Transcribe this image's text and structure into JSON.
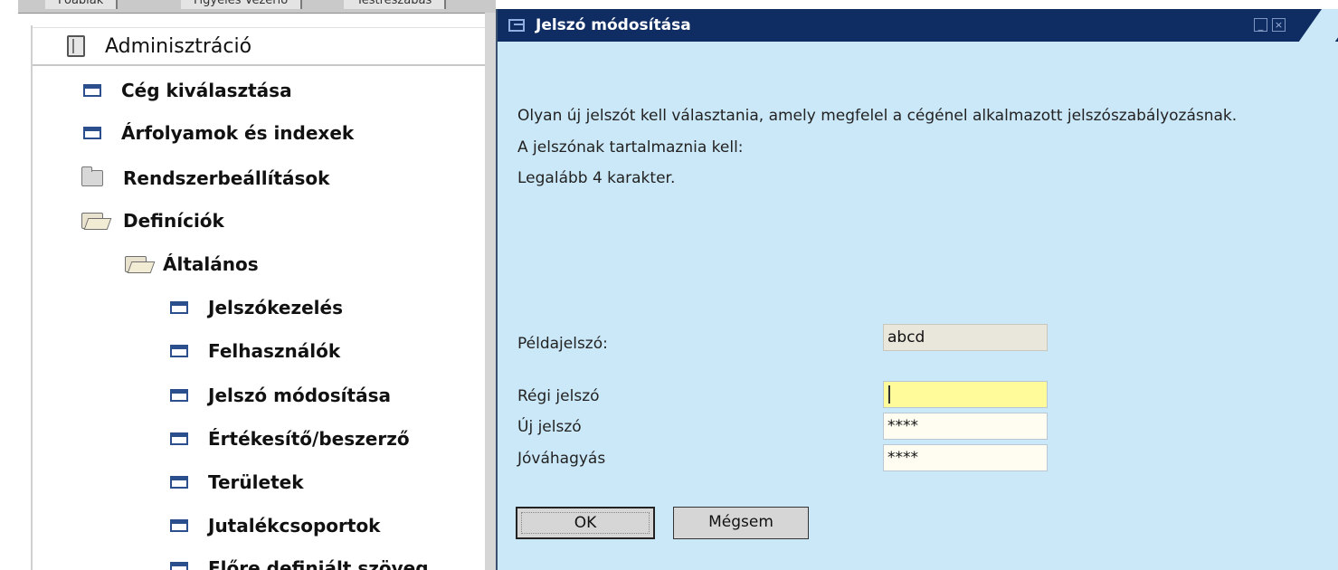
{
  "tabs": [
    "Főablak",
    "Figyelés Vezérlő",
    "Testreszabás"
  ],
  "tree": {
    "header": "Adminisztráció",
    "items": [
      {
        "label": "Cég kiválasztása",
        "icon": "window-icon"
      },
      {
        "label": "Árfolyamok és indexek",
        "icon": "window-icon"
      },
      {
        "label": "Rendszerbeállítások",
        "icon": "folder-icon"
      },
      {
        "label": "Definíciók",
        "icon": "folder-open-icon"
      },
      {
        "label": "Általános",
        "icon": "folder-open-icon"
      },
      {
        "label": "Jelszókezelés",
        "icon": "window-icon"
      },
      {
        "label": "Felhasználók",
        "icon": "window-icon"
      },
      {
        "label": "Jelszó módosítása",
        "icon": "window-icon"
      },
      {
        "label": "Értékesítő/beszerző",
        "icon": "window-icon"
      },
      {
        "label": "Területek",
        "icon": "window-icon"
      },
      {
        "label": "Jutalékcsoportok",
        "icon": "window-icon"
      },
      {
        "label": "Előre definiált szöveg",
        "icon": "window-icon"
      }
    ]
  },
  "dialog": {
    "title": "Jelszó módosítása",
    "message_lines": [
      "Olyan új jelszót kell választania, amely megfelel a cégénel alkalmazott jelszószabályozásnak.",
      "A jelszónak tartalmaznia kell:",
      "Legalább 4 karakter."
    ],
    "fields": {
      "example_label": "Példajelszó:",
      "example_value": "abcd",
      "old_label": "Régi jelszó",
      "old_value": "",
      "new_label": "Új jelszó",
      "new_value": "****",
      "confirm_label": "Jóváhagyás",
      "confirm_value": "****"
    },
    "buttons": {
      "ok": "OK",
      "cancel": "Mégsem"
    }
  },
  "colors": {
    "dialog_background": "#cbe8f8",
    "titlebar": "#0f2c63",
    "active_field": "#fffa9a"
  }
}
